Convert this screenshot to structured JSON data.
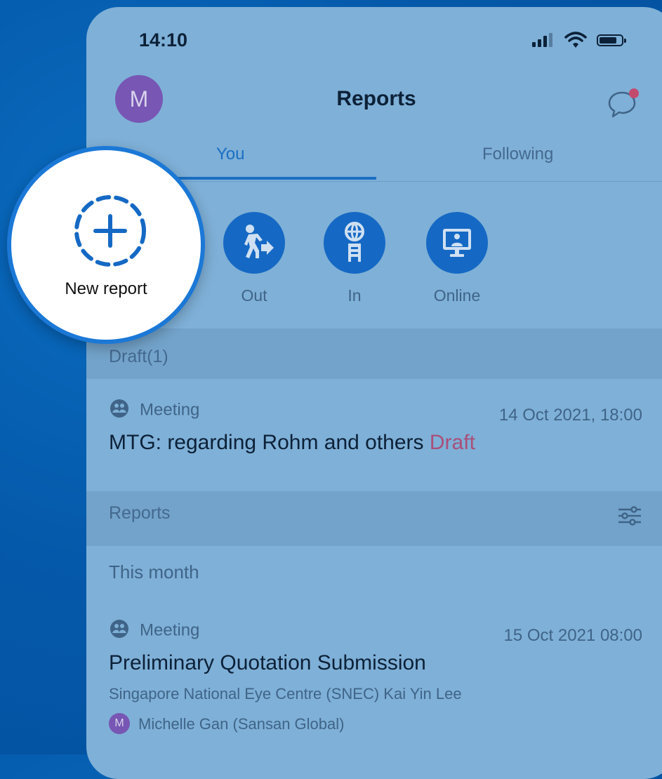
{
  "status_bar": {
    "time": "14:10"
  },
  "header": {
    "avatar_initial": "M",
    "title": "Reports"
  },
  "tabs": [
    {
      "label": "You",
      "selected": true
    },
    {
      "label": "Following",
      "selected": false
    }
  ],
  "actions": [
    {
      "label": "New report",
      "icon": "add-dashed-circle-icon"
    },
    {
      "label": "Out",
      "icon": "person-walking-out-icon"
    },
    {
      "label": "In",
      "icon": "globe-building-icon"
    },
    {
      "label": "Online",
      "icon": "monitor-person-icon"
    }
  ],
  "drafts": {
    "heading": "Draft(1)",
    "items": [
      {
        "type": "Meeting",
        "date": "14 Oct 2021, 18:00",
        "title": "MTG: regarding Rohm and others",
        "tag": "Draft"
      }
    ]
  },
  "reports": {
    "heading": "Reports",
    "group": "This month",
    "items": [
      {
        "type": "Meeting",
        "date": "15 Oct 2021 08:00",
        "title": "Preliminary Quotation Submission",
        "subtitle": "Singapore National Eye Centre (SNEC) Kai Yin Lee",
        "person_initial": "M",
        "person": "Michelle Gan (Sansan Global)"
      }
    ]
  },
  "colors": {
    "accent": "#1569c4",
    "avatar": "#7756b4",
    "draft_tag": "#a8507a",
    "notification_dot": "#c24a6e"
  }
}
